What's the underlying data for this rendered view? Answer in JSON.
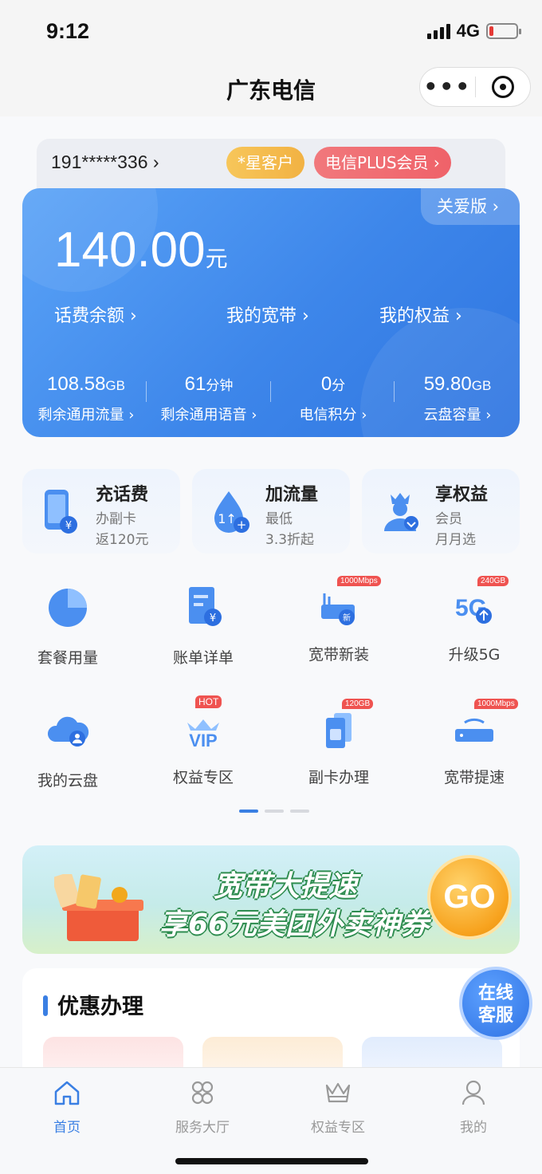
{
  "status": {
    "time": "9:12",
    "network": "4G"
  },
  "nav": {
    "title": "广东电信"
  },
  "account": {
    "phone": "191*****336 ›",
    "star_badge": "*星客户",
    "plus_badge": "电信PLUS会员 ›"
  },
  "balance": {
    "care_mode": "关爱版 ›",
    "amount": "140.00",
    "unit": "元",
    "links": [
      "话费余额 ›",
      "我的宽带 ›",
      "我的权益 ›"
    ],
    "stats": [
      {
        "value": "108.58",
        "unit": "GB",
        "label": "剩余通用流量 ›"
      },
      {
        "value": "61",
        "unit": "分钟",
        "label": "剩余通用语音 ›"
      },
      {
        "value": "0",
        "unit": "分",
        "label": "电信积分 ›"
      },
      {
        "value": "59.80",
        "unit": "GB",
        "label": "云盘容量 ›"
      }
    ]
  },
  "quick": [
    {
      "title": "充话费",
      "sub1": "办副卡",
      "sub2": "返120元",
      "icon": "phone-recharge-icon"
    },
    {
      "title": "加流量",
      "sub1": "最低",
      "sub2": "3.3折起",
      "icon": "data-drop-icon"
    },
    {
      "title": "享权益",
      "sub1": "会员",
      "sub2": "月月选",
      "icon": "member-icon"
    }
  ],
  "grid": [
    {
      "label": "套餐用量",
      "icon": "pie-chart-icon"
    },
    {
      "label": "账单详单",
      "icon": "bill-icon"
    },
    {
      "label": "宽带新装",
      "icon": "router-icon",
      "tag": "1000Mbps"
    },
    {
      "label": "升级5G",
      "icon": "5g-icon",
      "tag": "240GB"
    },
    {
      "label": "我的云盘",
      "icon": "cloud-icon"
    },
    {
      "label": "权益专区",
      "icon": "vip-icon",
      "tag": "HOT"
    },
    {
      "label": "副卡办理",
      "icon": "sim-card-icon",
      "tag": "120GB"
    },
    {
      "label": "宽带提速",
      "icon": "router-speed-icon",
      "tag": "1000Mbps"
    }
  ],
  "banner": {
    "line1": "宽带大提速",
    "line2": "享66元美团外卖神券",
    "go": "GO"
  },
  "promo": {
    "title": "优惠办理"
  },
  "customer_service": {
    "line1": "在线",
    "line2": "客服"
  },
  "tabs": [
    {
      "label": "首页",
      "icon": "home-icon",
      "active": true
    },
    {
      "label": "服务大厅",
      "icon": "service-hall-icon"
    },
    {
      "label": "权益专区",
      "icon": "crown-icon"
    },
    {
      "label": "我的",
      "icon": "profile-icon"
    }
  ],
  "colors": {
    "accent": "#3a7fe3",
    "card_blue": "#4a92ef",
    "star_badge": "#f5bc4f",
    "plus_badge": "#ef6b70"
  }
}
